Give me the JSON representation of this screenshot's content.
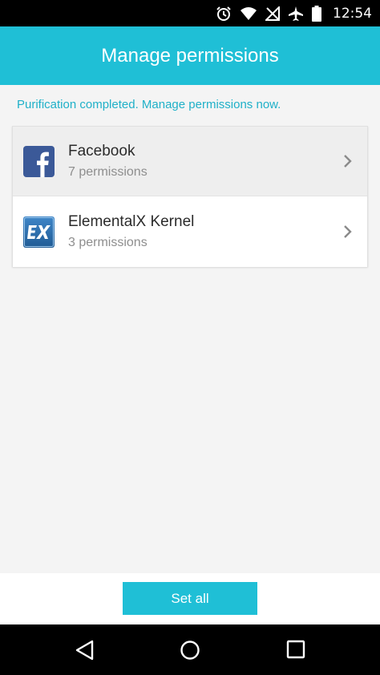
{
  "status_bar": {
    "time": "12:54",
    "icons": [
      "alarm-icon",
      "wifi-icon",
      "no-signal-icon",
      "airplane-icon",
      "battery-icon"
    ]
  },
  "app_bar": {
    "title": "Manage permissions"
  },
  "info": {
    "text": "Purification completed. Manage permissions now."
  },
  "apps": [
    {
      "name": "Facebook",
      "permissions": "7 permissions",
      "icon": "facebook-icon"
    },
    {
      "name": "ElementalX Kernel",
      "permissions": "3 permissions",
      "icon": "elementalx-icon"
    }
  ],
  "footer": {
    "set_all_label": "Set all"
  },
  "nav": {
    "icons": [
      "back-icon",
      "home-icon",
      "recents-icon"
    ]
  },
  "colors": {
    "accent": "#1fbfd6",
    "info_text": "#1fb0c8",
    "facebook": "#3b5998",
    "elementalx": "#2a6aa8"
  }
}
